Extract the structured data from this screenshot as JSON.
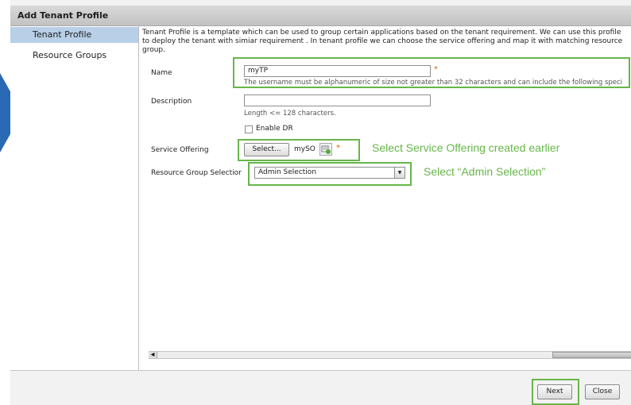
{
  "dialog": {
    "title": "Add Tenant Profile"
  },
  "sidebar": {
    "items": [
      {
        "label": "Tenant Profile",
        "selected": true
      },
      {
        "label": "Resource Groups",
        "selected": false
      }
    ]
  },
  "form": {
    "description": "Tenant Profile is a template which  can be used to group certain applications based on the tenant requirement. We can use this profile to deploy the tenant with simiar requirement . In tenant profile we can choose the service offering and map it with matching resource group.",
    "name": {
      "label": "Name",
      "value": "myTP",
      "hint": "The username must be alphanumeric of size not greater than 32 characters and can include the following speci",
      "required_mark": "*"
    },
    "description_field": {
      "label": "Description",
      "value": "",
      "hint": "Length <= 128 characters."
    },
    "enable_dr": {
      "label": "Enable DR",
      "checked": false
    },
    "service_offering": {
      "label": "Service Offering",
      "button_label": "Select...",
      "value": "mySO",
      "required_mark": "*"
    },
    "resource_group_selection": {
      "label": "Resource Group Selectior",
      "selected": "Admin Selection"
    }
  },
  "annotations": {
    "service_offering": "Select Service Offering created earlier",
    "resource_group": "Select “Admin Selection”"
  },
  "footer": {
    "next_label": "Next",
    "close_label": "Close"
  },
  "colors": {
    "highlight_box": "#67b64a",
    "selected_nav": "#b8cfe7",
    "required": "#e0620a",
    "arrow": "#2a69b3"
  }
}
